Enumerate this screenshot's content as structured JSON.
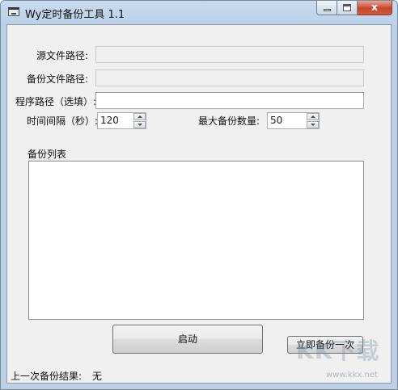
{
  "window": {
    "title": "Wy定时备份工具 1.1",
    "close_glyph": "x"
  },
  "form": {
    "source_path_label": "源文件路径:",
    "source_path_value": "",
    "backup_path_label": "备份文件路径:",
    "backup_path_value": "",
    "program_path_label": "程序路径（选填）:",
    "program_path_value": "",
    "interval_label": "时间间隔（秒）:",
    "interval_value": "120",
    "max_backups_label": "最大备份数量:",
    "max_backups_value": "50",
    "backup_list_label": "备份列表",
    "backup_list_items": []
  },
  "buttons": {
    "start_label": "启动",
    "backup_now_label": "立即备份一次"
  },
  "status": {
    "last_result_label": "上一次备份结果:",
    "last_result_value": "无"
  },
  "watermark": {
    "main": "KK下载",
    "sub": "www.kkx.net"
  },
  "colors": {
    "close_button": "#c8452c",
    "frame": "#bcd1e8",
    "client_bg": "#f0f0f0"
  }
}
